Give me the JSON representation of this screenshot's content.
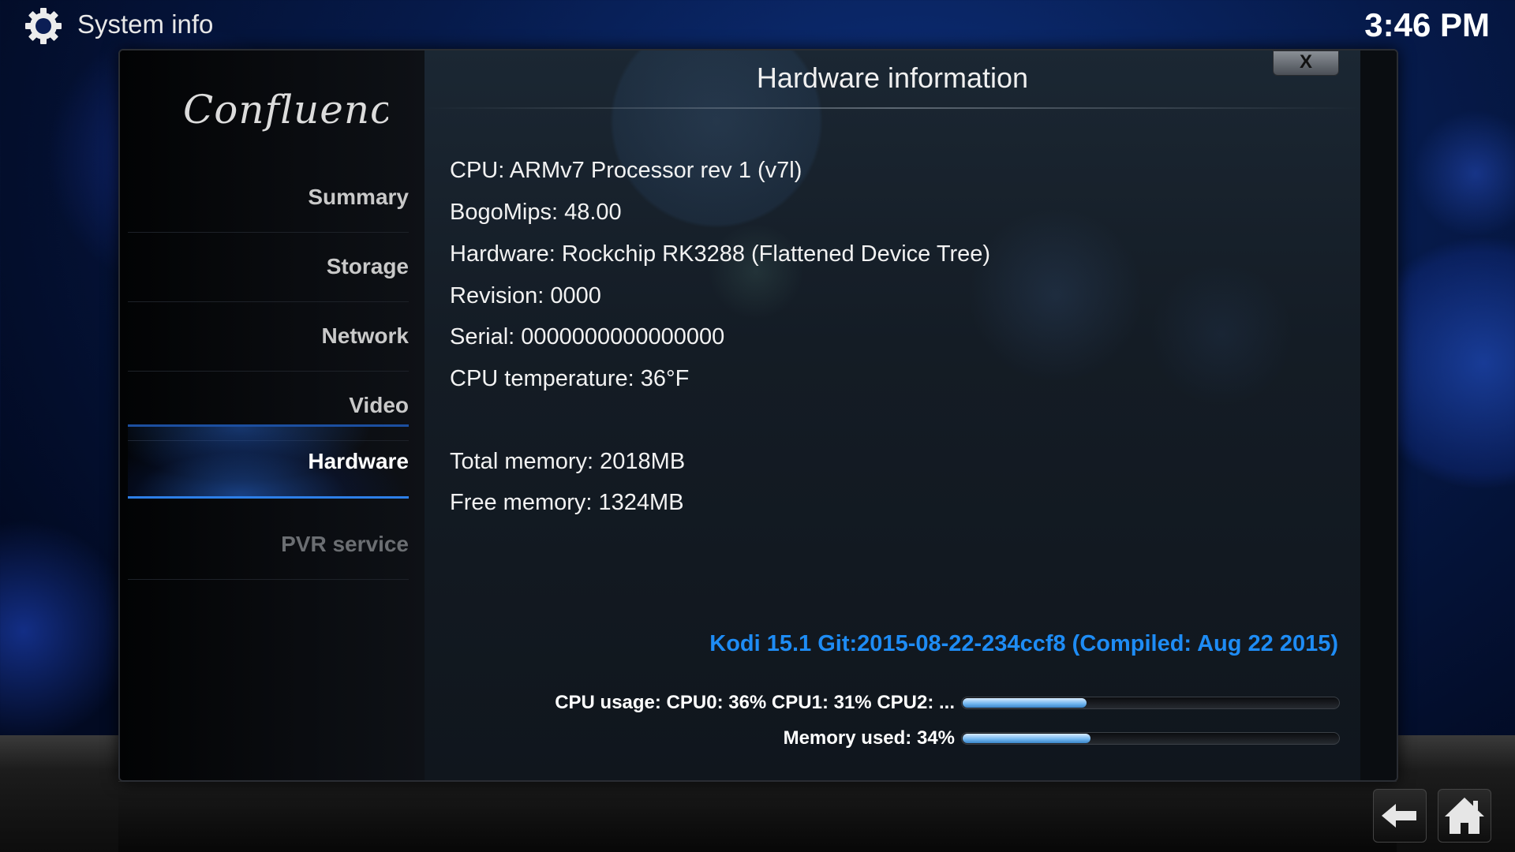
{
  "header": {
    "title": "System info",
    "clock": "3:46 PM",
    "icon": "gear-icon"
  },
  "dialog": {
    "logo_text": "Confluence",
    "title": "Hardware information",
    "close_label": "X"
  },
  "sidebar": {
    "items": [
      {
        "label": "Summary",
        "state": "normal"
      },
      {
        "label": "Storage",
        "state": "normal"
      },
      {
        "label": "Network",
        "state": "normal"
      },
      {
        "label": "Video",
        "state": "normal"
      },
      {
        "label": "Hardware",
        "state": "active"
      },
      {
        "label": "PVR service",
        "state": "disabled"
      }
    ]
  },
  "info": {
    "lines": [
      "CPU: ARMv7 Processor rev 1 (v7l)",
      "BogoMips: 48.00",
      "Hardware: Rockchip RK3288 (Flattened Device Tree)",
      "Revision: 0000",
      "Serial: 0000000000000000",
      "CPU temperature: 36°F",
      "Total memory: 2018MB",
      "Free memory: 1324MB"
    ],
    "version": "Kodi 15.1 Git:2015-08-22-234ccf8 (Compiled: Aug 22 2015)"
  },
  "usage": {
    "cpu_label": "CPU usage: CPU0:  36% CPU1:  31% CPU2: ...",
    "cpu_percent": 33,
    "memory_label": "Memory used: 34%",
    "memory_percent": 34
  },
  "footer": {
    "back_icon": "back-arrow-icon",
    "home_icon": "home-icon"
  },
  "colors": {
    "accent": "#1e8cf5",
    "bar_fill": "#6fb4ee"
  }
}
